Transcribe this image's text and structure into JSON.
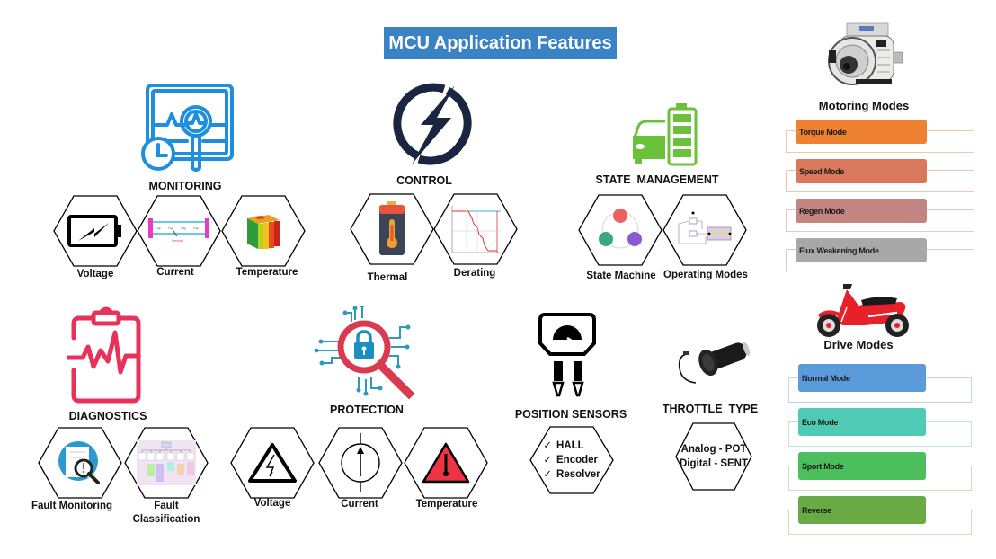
{
  "title": "MCU Application Features",
  "colors": {
    "title_bg": "#3b82c4",
    "monitoring_icon": "#1e8fe0",
    "control_icon": "#1a2540",
    "state_icon": "#6cc13b",
    "diagnostics_icon": "#e8325a",
    "protection_magnifier": "#d93a4f",
    "protection_circuit": "#2a9bb8"
  },
  "sections": {
    "monitoring": {
      "heading": "MONITORING",
      "items": [
        {
          "label": "Voltage",
          "icon": "battery-bolt-icon"
        },
        {
          "label": "Current",
          "icon": "current-diagram-icon"
        },
        {
          "label": "Temperature",
          "icon": "thermal-cube-icon"
        }
      ]
    },
    "control": {
      "heading": "CONTROL",
      "items": [
        {
          "label": "Thermal",
          "icon": "battery-thermometer-icon"
        },
        {
          "label": "Derating",
          "icon": "derating-chart-icon"
        }
      ]
    },
    "state_management": {
      "heading": "STATE  MANAGEMENT",
      "items": [
        {
          "label": "State Machine",
          "icon": "state-machine-icon"
        },
        {
          "label": "Operating Modes",
          "icon": "operating-modes-diagram-icon"
        }
      ]
    },
    "diagnostics": {
      "heading": "DIAGNOSTICS",
      "items": [
        {
          "label": "Fault Monitoring",
          "icon": "fault-search-icon"
        },
        {
          "label": "Fault\nClassification",
          "label_line1": "Fault",
          "label_line2": "Classification",
          "icon": "fault-tree-icon"
        }
      ]
    },
    "protection": {
      "heading": "PROTECTION",
      "items": [
        {
          "label": "Voltage",
          "icon": "high-voltage-warning-icon"
        },
        {
          "label": "Current",
          "icon": "current-source-icon"
        },
        {
          "label": "Temperature",
          "icon": "temperature-warning-icon"
        }
      ]
    },
    "position_sensors": {
      "heading": "POSITION SENSORS",
      "items": [
        "HALL",
        "Encoder",
        "Resolver"
      ],
      "check": "✓"
    },
    "throttle_type": {
      "heading": "THROTTLE  TYPE",
      "items": [
        "Analog - POT",
        "Digital - SENT"
      ]
    }
  },
  "motoring_modes": {
    "heading": "Motoring Modes",
    "modes": [
      {
        "label": "Torque Mode",
        "color": "#ee8232",
        "border": "#f0c9a6"
      },
      {
        "label": "Speed Mode",
        "color": "#d9785a",
        "border": "#ebc6b6"
      },
      {
        "label": "Regen Mode",
        "color": "#c2857f",
        "border": "#e0c9c6"
      },
      {
        "label": "Flux Weakening Mode",
        "color": "#a8a8a8",
        "border": "#cfcfcf"
      }
    ]
  },
  "drive_modes": {
    "heading": "Drive Modes",
    "modes": [
      {
        "label": "Normal Mode",
        "color": "#5b9bd9",
        "border": "#bcd6e6"
      },
      {
        "label": "Eco Mode",
        "color": "#4fcab4",
        "border": "#bde6dd"
      },
      {
        "label": "Sport Mode",
        "color": "#4cbe5c",
        "border": "#bfe2c4"
      },
      {
        "label": "Reverse",
        "color": "#6aaa45",
        "border": "#cbe0bd"
      }
    ]
  }
}
